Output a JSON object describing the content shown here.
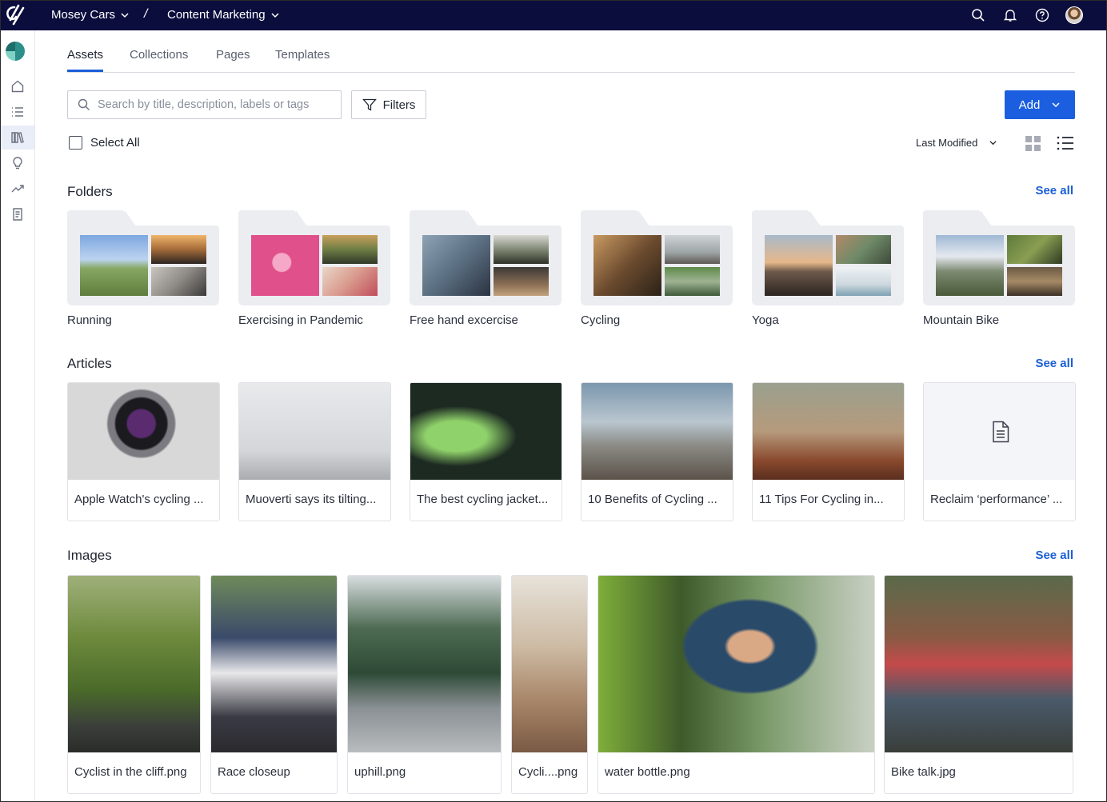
{
  "topbar": {
    "workspace": "Mosey Cars",
    "separator": "/",
    "project": "Content Marketing",
    "icons": [
      "search-icon",
      "bell-icon",
      "help-icon",
      "avatar"
    ]
  },
  "sidebar": {
    "items": [
      "home-icon",
      "list-icon",
      "library-icon",
      "lightbulb-icon",
      "trending-icon",
      "document-icon"
    ],
    "active": "library-icon"
  },
  "tabs": [
    {
      "label": "Assets",
      "active": true
    },
    {
      "label": "Collections",
      "active": false
    },
    {
      "label": "Pages",
      "active": false
    },
    {
      "label": "Templates",
      "active": false
    }
  ],
  "toolbar": {
    "search_placeholder": "Search by title, description, labels or tags",
    "filters_label": "Filters",
    "add_label": "Add",
    "select_all_label": "Select All",
    "sort_label": "Last Modified"
  },
  "folders": {
    "title": "Folders",
    "see_all": "See all",
    "items": [
      {
        "label": "Running"
      },
      {
        "label": "Exercising in Pandemic"
      },
      {
        "label": "Free hand excercise"
      },
      {
        "label": "Cycling"
      },
      {
        "label": "Yoga"
      },
      {
        "label": "Mountain Bike"
      }
    ]
  },
  "articles": {
    "title": "Articles",
    "see_all": "See all",
    "items": [
      {
        "caption": "Apple Watch's cycling ..."
      },
      {
        "caption": "Muoverti says its tilting..."
      },
      {
        "caption": "The best cycling jacket..."
      },
      {
        "caption": "10 Benefits of Cycling ..."
      },
      {
        "caption": "11 Tips For Cycling in..."
      },
      {
        "caption": "Reclaim ‘performance’ ..."
      }
    ]
  },
  "images": {
    "title": "Images",
    "see_all": "See all",
    "items": [
      {
        "caption": "Cyclist in the cliff.png"
      },
      {
        "caption": "Race closeup"
      },
      {
        "caption": "uphill.png"
      },
      {
        "caption": "Cycli....png"
      },
      {
        "caption": "water bottle.png"
      },
      {
        "caption": "Bike talk.jpg"
      }
    ]
  },
  "colors": {
    "topbar_bg": "#0b0d3d",
    "accent": "#1b5fe0",
    "link": "#1a5ed8",
    "folder_bg": "#ecedf1"
  }
}
